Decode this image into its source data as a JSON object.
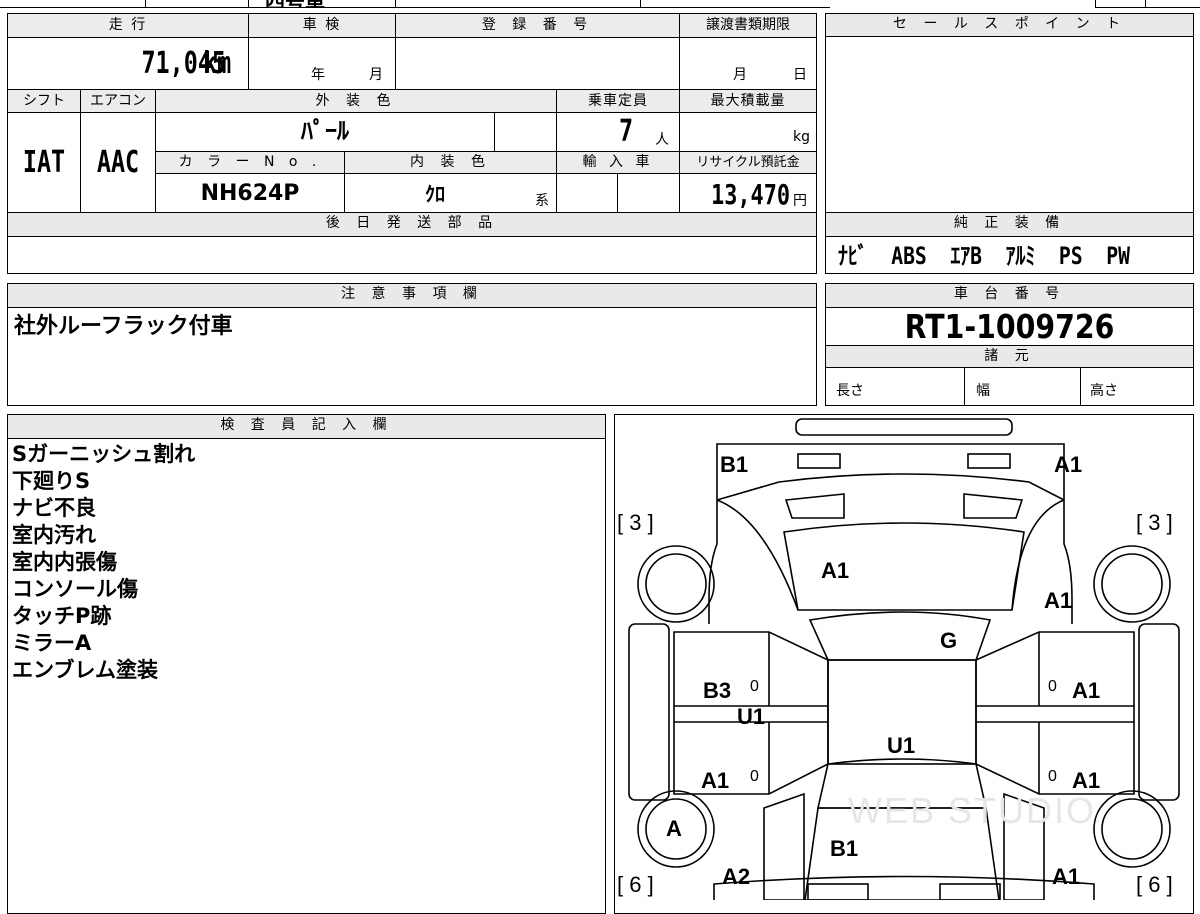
{
  "top_strip": {
    "partial_text": "四号車"
  },
  "headers": {
    "mileage": "走 行",
    "inspection": "車 検",
    "registration_no": "登 録 番 号",
    "transfer_deadline": "譲渡書類期限",
    "sales_point": "セ ー ル ス ポ イ ン ト",
    "shift": "シフト",
    "aircon": "エアコン",
    "exterior_color": "外 装 色",
    "capacity": "乗車定員",
    "max_load": "最大積載量",
    "color_no": "カ ラ ー N o .",
    "interior_color": "内 装 色",
    "import": "輸 入 車",
    "recycle_fee": "リサイクル預託金",
    "later_parts": "後 日 発 送 部 品",
    "genuine_equipment": "純 正 装 備",
    "caution": "注 意 事 項 欄",
    "chassis_no": "車 台 番 号",
    "specs": "諸 元",
    "inspector_notes": "検 査 員 記 入 欄"
  },
  "vehicle": {
    "mileage": "71,045",
    "mileage_unit": "km",
    "inspection_year_unit": "年",
    "inspection_month_unit": "月",
    "deadline_month_unit": "月",
    "deadline_day_unit": "日",
    "shift": "IAT",
    "aircon": "AAC",
    "exterior_color": "ﾊﾟｰﾙ",
    "capacity": "7",
    "capacity_unit": "人",
    "load_unit": "kg",
    "color_no": "NH624P",
    "interior_color": "ｸﾛ",
    "interior_suffix": "系",
    "recycle_fee": "13,470",
    "recycle_unit": "円",
    "genuine_equipment": "ﾅﾋﾞ  ABS  ｴｱB  ｱﾙﾐ  PS  PW",
    "caution_text": "社外ルーフラック付車",
    "chassis_no": "RT1-1009726",
    "spec_length": "長さ",
    "spec_width": "幅",
    "spec_height": "高さ"
  },
  "inspector_notes": [
    "Sガーニッシュ割れ",
    "下廻りS",
    "ナビ不良",
    "室内汚れ",
    "室内内張傷",
    "コンソール傷",
    "タッチP跡",
    "ミラーA",
    "エンブレム塗装"
  ],
  "diagram": {
    "watermark": "WEB STUDIO",
    "tire_front_left": "[ 3 ]",
    "tire_front_right": "[ 3 ]",
    "tire_rear_left": "[ 6 ]",
    "tire_rear_right": "[ 6 ]",
    "marks": {
      "rear_left": "B1",
      "rear_right": "A1",
      "roof": "A1",
      "right_quarter": "A1",
      "glass": "G",
      "left_rear_door": "B3",
      "left_rear_door_sub": "U1",
      "right_rear_door": "A1",
      "center": "U1",
      "left_front_door": "A1",
      "right_front_door": "A1",
      "left_front_wheel": "A",
      "hood": "B1",
      "left_fender": "A2",
      "right_fender": "A1",
      "small_zero": "0"
    }
  }
}
